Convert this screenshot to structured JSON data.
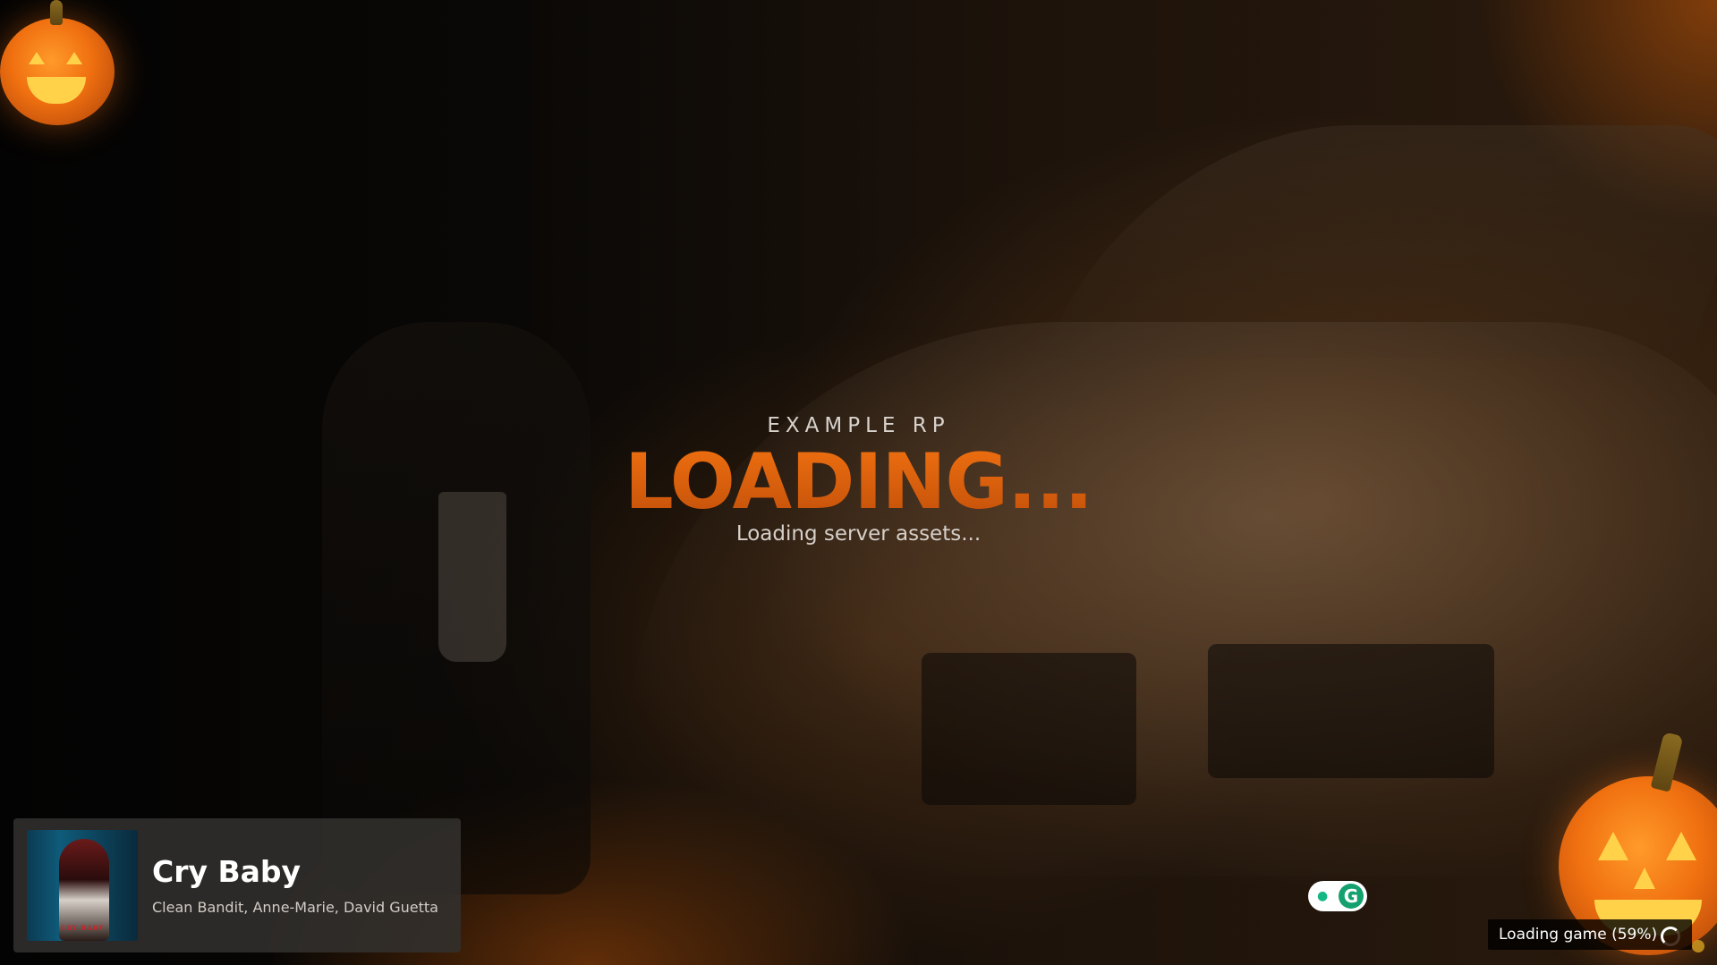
{
  "header": {
    "server_name": "EXAMPLE RP",
    "title": "LOADING...",
    "subtitle": "Loading server assets..."
  },
  "music_player": {
    "song_title": "Cry Baby",
    "artists": "Clean Bandit, Anne-Marie, David Guetta",
    "album_art_label": "CRY BABY"
  },
  "status": {
    "text": "Loading game (59%)",
    "progress_percent": 59
  },
  "decorations": {
    "top_left": "jack-o-lantern-icon",
    "bottom_right": "jack-o-lantern-icon"
  },
  "colors": {
    "accent": "#e8680e",
    "background": "#060504",
    "player_bg": "#32302e",
    "assist_green": "#15a16e"
  }
}
